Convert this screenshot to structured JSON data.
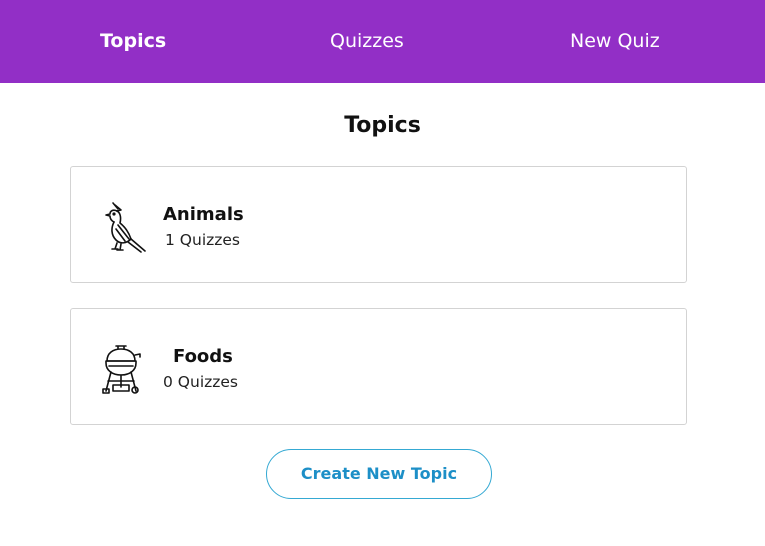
{
  "nav": {
    "items": [
      {
        "label": "Topics",
        "active": true
      },
      {
        "label": "Quizzes",
        "active": false
      },
      {
        "label": "New Quiz",
        "active": false
      }
    ],
    "background_color": "#922fc6"
  },
  "page": {
    "title": "Topics"
  },
  "topics": [
    {
      "icon": "bird-icon",
      "name": "Animals",
      "quiz_count": "1 Quizzes"
    },
    {
      "icon": "grill-icon",
      "name": "Foods",
      "quiz_count": "0 Quizzes"
    }
  ],
  "actions": {
    "create_label": "Create New Topic",
    "accent_color": "#1d8fc7"
  }
}
